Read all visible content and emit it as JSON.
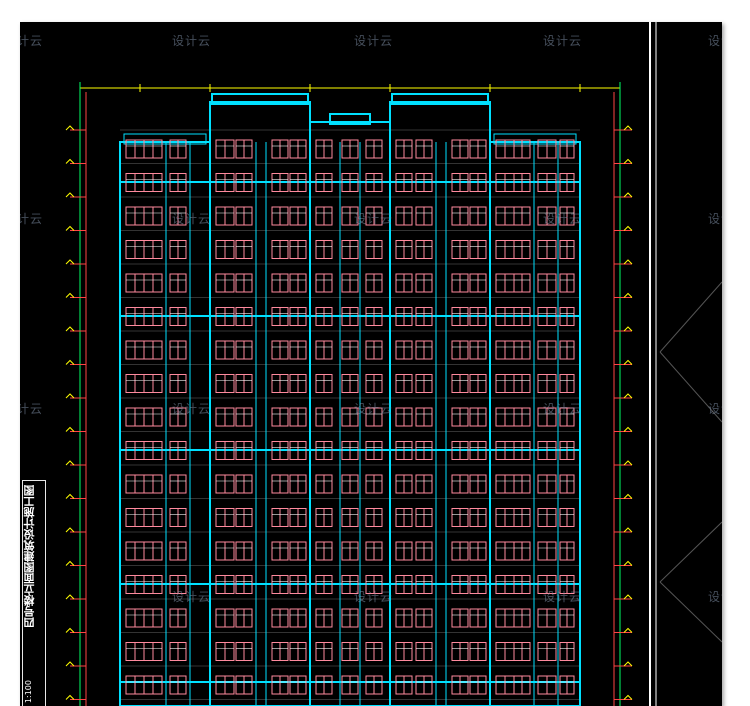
{
  "watermark": {
    "text": "设计云"
  },
  "title_block": {
    "title": "四号楼立面图建筑设计施工图",
    "number": "1:100"
  },
  "colors": {
    "sheet_bg": "#000000",
    "structure": "#00e0ff",
    "windows": "#ff8a9e",
    "dimension": "#ffff00",
    "grid": "#00ff66",
    "level_marks": "#ff4444",
    "frame_line": "#ffffff"
  },
  "drawing": {
    "kind": "building-elevation",
    "floors_visible": 17
  }
}
